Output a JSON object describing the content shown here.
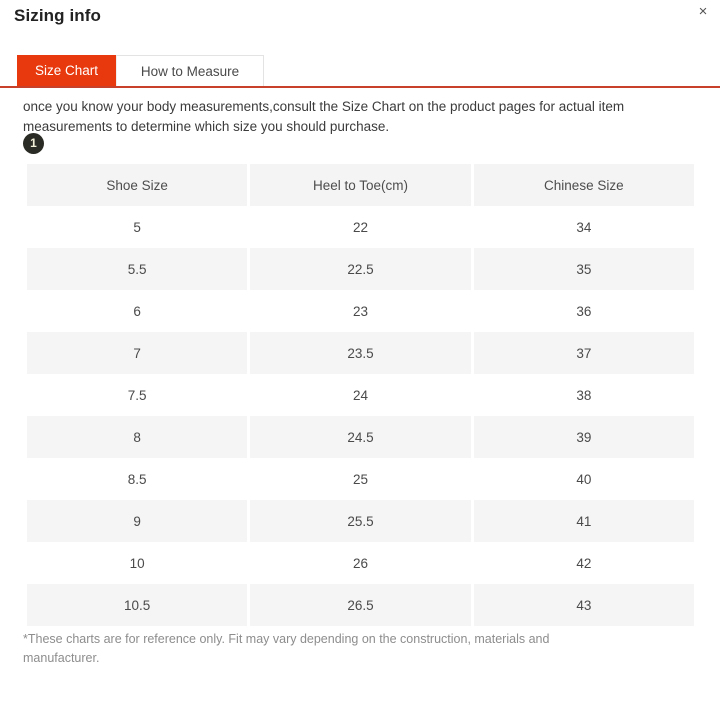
{
  "modal": {
    "title": "Sizing info",
    "close_icon": "close-icon",
    "close_glyph": "×"
  },
  "tabs": [
    {
      "label": "Size Chart",
      "active": true
    },
    {
      "label": "How to Measure",
      "active": false
    }
  ],
  "intro": {
    "text": "once you know your body measurements,consult the Size Chart on the product pages for actual item measurements to determine which size you should purchase."
  },
  "step_badge": {
    "number": "1"
  },
  "chart_data": {
    "type": "table",
    "title": "Size Chart",
    "columns": [
      "Shoe Size",
      "Heel to Toe(cm)",
      "Chinese Size"
    ],
    "rows": [
      [
        "5",
        "22",
        "34"
      ],
      [
        "5.5",
        "22.5",
        "35"
      ],
      [
        "6",
        "23",
        "36"
      ],
      [
        "7",
        "23.5",
        "37"
      ],
      [
        "7.5",
        "24",
        "38"
      ],
      [
        "8",
        "24.5",
        "39"
      ],
      [
        "8.5",
        "25",
        "40"
      ],
      [
        "9",
        "25.5",
        "41"
      ],
      [
        "10",
        "26",
        "42"
      ],
      [
        "10.5",
        "26.5",
        "43"
      ]
    ]
  },
  "footnote": {
    "text": "*These charts are for reference only. Fit may vary depending on the construction, materials and manufacturer."
  },
  "colors": {
    "accent": "#e8380d",
    "rule": "#c8402a",
    "header_cell": "#f4f4f4",
    "stripe": "#f5f5f5",
    "badge_bg": "#2b2b25",
    "badge_text": "#f2efd8"
  }
}
